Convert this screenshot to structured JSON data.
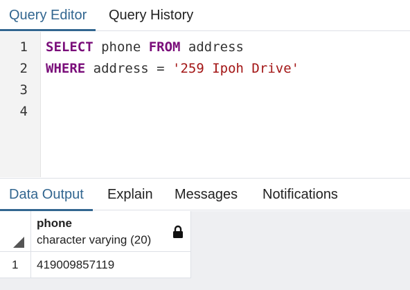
{
  "top_tabs": {
    "query_editor": "Query Editor",
    "query_history": "Query History",
    "active": "Query Editor"
  },
  "editor": {
    "line_numbers": [
      "1",
      "2",
      "3",
      "4"
    ],
    "lines": [
      [
        {
          "t": "SELECT",
          "k": "keyword"
        },
        {
          "t": " phone ",
          "k": "plain"
        },
        {
          "t": "FROM",
          "k": "keyword"
        },
        {
          "t": " address",
          "k": "plain"
        }
      ],
      [
        {
          "t": "WHERE",
          "k": "keyword"
        },
        {
          "t": " address = ",
          "k": "plain"
        },
        {
          "t": "'259 Ipoh Drive'",
          "k": "string"
        }
      ],
      [],
      []
    ]
  },
  "output_tabs": {
    "data_output": "Data Output",
    "explain": "Explain",
    "messages": "Messages",
    "notifications": "Notifications",
    "active": "Data Output"
  },
  "result_grid": {
    "columns": [
      {
        "name": "phone",
        "type": "character varying (20)",
        "icon": "lock-icon"
      }
    ],
    "rows": [
      {
        "row_number": "1",
        "cells": [
          "419009857119"
        ]
      }
    ]
  },
  "colors": {
    "accent": "#326690",
    "keyword": "#7a0e7a",
    "string": "#a31515"
  }
}
